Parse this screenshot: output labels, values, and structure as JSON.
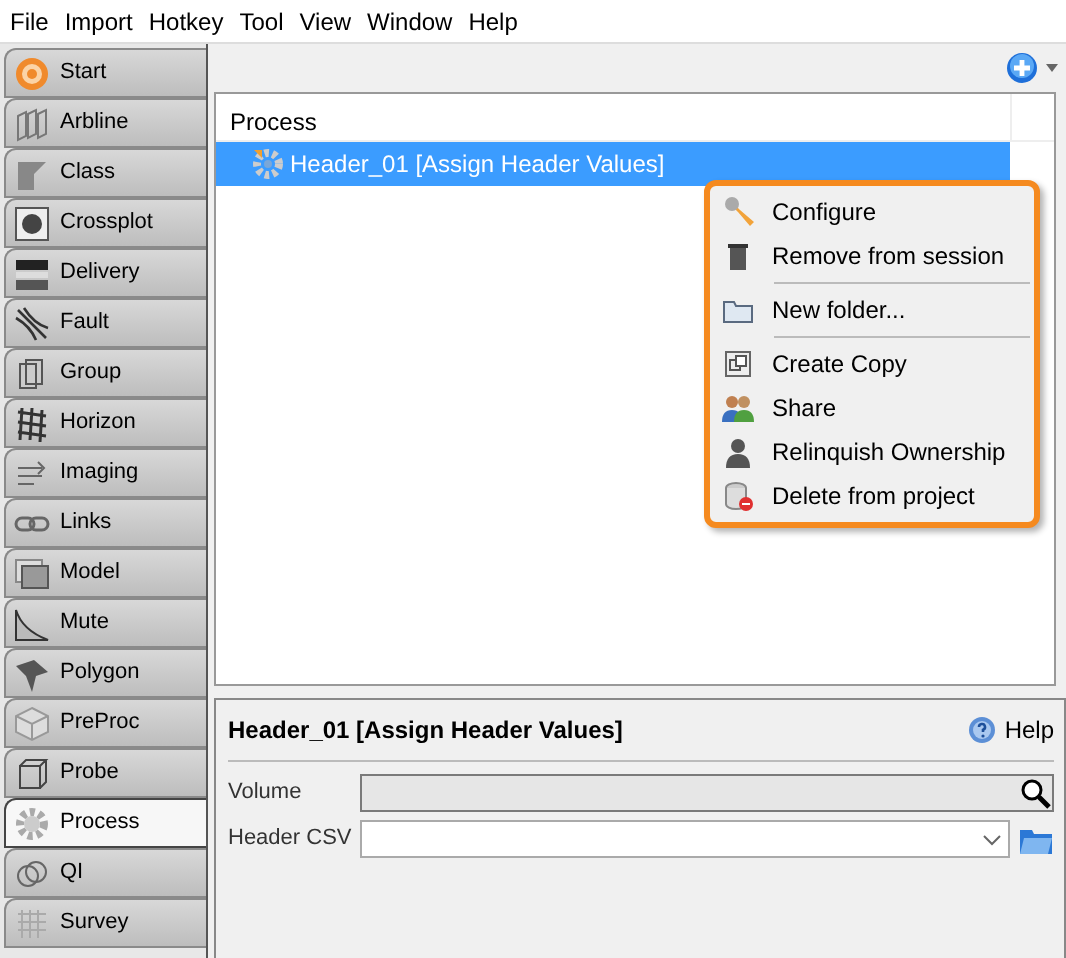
{
  "menu_bar": [
    "File",
    "Import",
    "Hotkey",
    "Tool",
    "View",
    "Window",
    "Help"
  ],
  "sidebar": {
    "tabs": [
      {
        "label": "Start",
        "selected": false
      },
      {
        "label": "Arbline",
        "selected": false
      },
      {
        "label": "Class",
        "selected": false
      },
      {
        "label": "Crossplot",
        "selected": false
      },
      {
        "label": "Delivery",
        "selected": false
      },
      {
        "label": "Fault",
        "selected": false
      },
      {
        "label": "Group",
        "selected": false
      },
      {
        "label": "Horizon",
        "selected": false
      },
      {
        "label": "Imaging",
        "selected": false
      },
      {
        "label": "Links",
        "selected": false
      },
      {
        "label": "Model",
        "selected": false
      },
      {
        "label": "Mute",
        "selected": false
      },
      {
        "label": "Polygon",
        "selected": false
      },
      {
        "label": "PreProc",
        "selected": false
      },
      {
        "label": "Probe",
        "selected": false
      },
      {
        "label": "Process",
        "selected": true
      },
      {
        "label": "QI",
        "selected": false
      },
      {
        "label": "Survey",
        "selected": false
      }
    ]
  },
  "tree": {
    "column": "Process",
    "rows": [
      {
        "label": "Header_01 [Assign Header Values]",
        "selected": true
      }
    ]
  },
  "context_menu": {
    "items": [
      {
        "kind": "item",
        "label": "Configure"
      },
      {
        "kind": "item",
        "label": "Remove from session"
      },
      {
        "kind": "separator"
      },
      {
        "kind": "item",
        "label": "New folder..."
      },
      {
        "kind": "separator"
      },
      {
        "kind": "item",
        "label": "Create Copy"
      },
      {
        "kind": "item",
        "label": "Share"
      },
      {
        "kind": "item",
        "label": "Relinquish Ownership"
      },
      {
        "kind": "item",
        "label": "Delete from project"
      }
    ]
  },
  "details": {
    "title": "Header_01 [Assign Header Values]",
    "help": "Help",
    "fields": [
      {
        "label": "Volume",
        "kind": "search"
      },
      {
        "label": "Header CSV",
        "kind": "combo"
      }
    ]
  }
}
